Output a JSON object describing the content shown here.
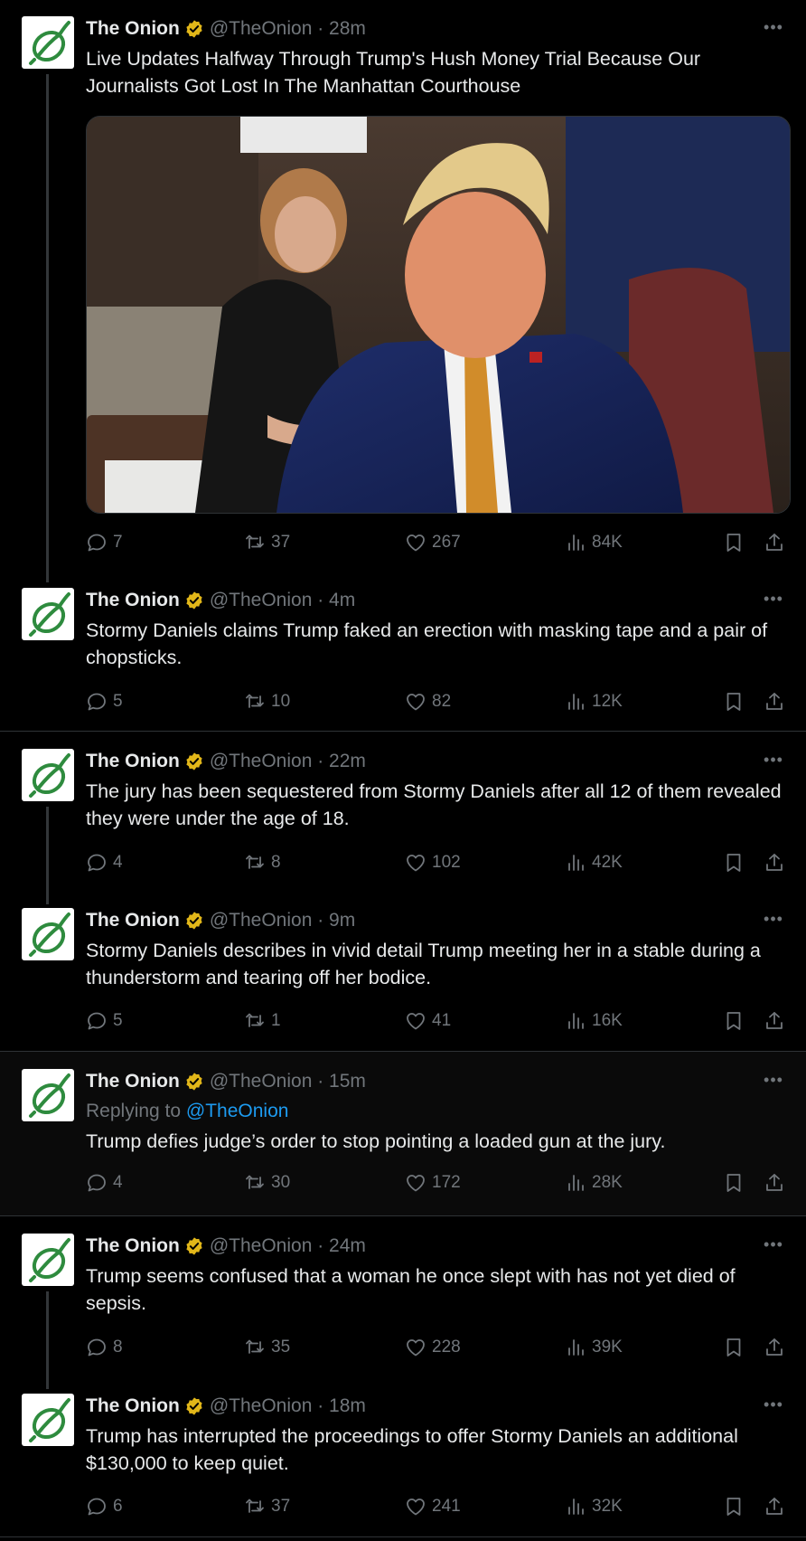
{
  "tweets": [
    {
      "name": "The Onion",
      "handle": "@TheOnion",
      "time": "28m",
      "text": "Live Updates Halfway Through Trump's Hush Money Trial Because Our Journalists Got Lost In The Manhattan Courthouse",
      "replies": "7",
      "retweets": "37",
      "likes": "267",
      "views": "84K"
    },
    {
      "name": "The Onion",
      "handle": "@TheOnion",
      "time": "4m",
      "text": "Stormy Daniels claims Trump faked an erection with masking tape and a pair of chopsticks.",
      "replies": "5",
      "retweets": "10",
      "likes": "82",
      "views": "12K"
    },
    {
      "name": "The Onion",
      "handle": "@TheOnion",
      "time": "22m",
      "text": "The jury has been sequestered from Stormy Daniels after all 12 of them revealed they were under the age of 18.",
      "replies": "4",
      "retweets": "8",
      "likes": "102",
      "views": "42K"
    },
    {
      "name": "The Onion",
      "handle": "@TheOnion",
      "time": "9m",
      "text": "Stormy Daniels describes in vivid detail Trump meeting her in a stable during a thunderstorm and tearing off her bodice.",
      "replies": "5",
      "retweets": "1",
      "likes": "41",
      "views": "16K"
    },
    {
      "name": "The Onion",
      "handle": "@TheOnion",
      "time": "15m",
      "replying_label": "Replying to",
      "replying_to": "@TheOnion",
      "text": "Trump defies judge’s order to stop pointing a loaded gun at the jury.",
      "replies": "4",
      "retweets": "30",
      "likes": "172",
      "views": "28K"
    },
    {
      "name": "The Onion",
      "handle": "@TheOnion",
      "time": "24m",
      "text": "Trump seems confused that a woman he once slept with has not yet died of sepsis.",
      "replies": "8",
      "retweets": "35",
      "likes": "228",
      "views": "39K"
    },
    {
      "name": "The Onion",
      "handle": "@TheOnion",
      "time": "18m",
      "text": "Trump has interrupted the proceedings to offer Stormy Daniels an additional $130,000 to keep quiet.",
      "replies": "6",
      "retweets": "37",
      "likes": "241",
      "views": "32K"
    }
  ],
  "icons": {
    "avatar": "onion-logo-icon",
    "verified": "verified-badge-icon",
    "more": "more-icon",
    "reply": "reply-icon",
    "retweet": "retweet-icon",
    "like": "like-icon",
    "views": "views-icon",
    "bookmark": "bookmark-icon",
    "share": "share-icon"
  },
  "colors": {
    "background": "#000000",
    "text": "#e7e9ea",
    "muted": "#71767b",
    "link": "#1d9bf0",
    "verified": "#e2b719",
    "onion_green": "#2e8b3e",
    "divider": "#2f3336"
  }
}
